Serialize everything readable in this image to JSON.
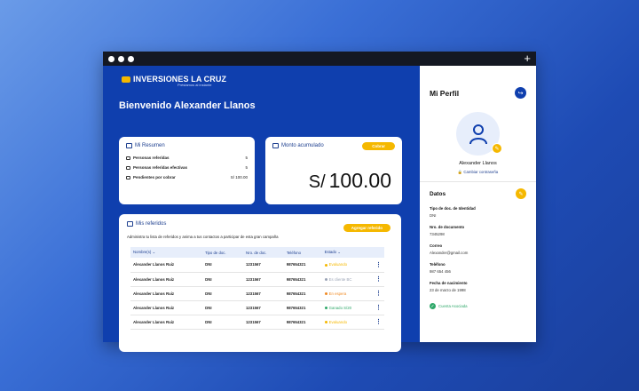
{
  "window": {
    "new_tab": "+"
  },
  "brand": {
    "name": "INVERSIONES LA CRUZ",
    "tagline": "Préstamos al instante"
  },
  "welcome": "Bienvenido Alexander Llanos",
  "resumen": {
    "title": "Mi Resumen",
    "rows": [
      {
        "label": "Personas referidas",
        "value": "5"
      },
      {
        "label": "Personas referidas efectivas",
        "value": "5"
      },
      {
        "label": "Pendientes por cobrar",
        "value": "S/ 100.00"
      }
    ]
  },
  "monto": {
    "title": "Monto acumulado",
    "button": "Cobrar",
    "currency": "S/",
    "amount": "100.00"
  },
  "referidos": {
    "title": "Mis referidos",
    "button": "Agregar referido",
    "description": "Administra tu lista de referidos y anima a tus contactos a participar de esta gran campaña",
    "columns": [
      "Nombre(s)",
      "Tipo de doc.",
      "Nro. de doc.",
      "Teléfono",
      "Estado"
    ],
    "rows": [
      {
        "name": "Alexander Llanos Ruiz",
        "doc_type": "DNI",
        "doc_num": "1231567",
        "phone": "987654321",
        "status": "Evaluando",
        "status_color": "#f5b800"
      },
      {
        "name": "Alexander Llanos Ruiz",
        "doc_type": "DNI",
        "doc_num": "1231567",
        "phone": "987654321",
        "status": "Es cliente BC",
        "status_color": "#9aa3b5"
      },
      {
        "name": "Alexander Llanos Ruiz",
        "doc_type": "DNI",
        "doc_num": "1231567",
        "phone": "987654321",
        "status": "En espera",
        "status_color": "#f08a24"
      },
      {
        "name": "Alexander Llanos Ruiz",
        "doc_type": "DNI",
        "doc_num": "1231567",
        "phone": "987654321",
        "status": "Ganado S/20",
        "status_color": "#2fa86a"
      },
      {
        "name": "Alexander Llanos Ruiz",
        "doc_type": "DNI",
        "doc_num": "1231567",
        "phone": "987654321",
        "status": "Evaluando",
        "status_color": "#f5b800"
      }
    ]
  },
  "perfil": {
    "title": "Mi Perfil",
    "name": "Alexander Llanos",
    "change_password": "Cambiar contraseña",
    "datos_title": "Datos",
    "fields": [
      {
        "label": "Tipo de doc. de Identidad",
        "value": "DNI"
      },
      {
        "label": "Nro. de documento",
        "value": "7345298"
      },
      {
        "label": "Correo",
        "value": "Alexander@gmail.com"
      },
      {
        "label": "Teléfono",
        "value": "987 654 456"
      },
      {
        "label": "Fecha de nacimiento",
        "value": "23 de marzo de 1998"
      }
    ],
    "verified": "Cuenta Asociada"
  },
  "colors": {
    "primary": "#0f3fae",
    "accent": "#f5b800"
  }
}
